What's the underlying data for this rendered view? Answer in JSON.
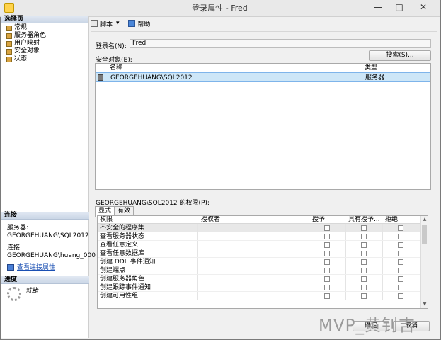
{
  "window": {
    "title": "登录属性 - Fred",
    "controls": {
      "minimize": "—",
      "maximize": "□",
      "close": "✕"
    }
  },
  "left": {
    "select_page_header": "选择页",
    "pages": [
      {
        "label": "常规",
        "icon": "wrench-icon"
      },
      {
        "label": "服务器角色",
        "icon": "wrench-icon"
      },
      {
        "label": "用户映射",
        "icon": "wrench-icon"
      },
      {
        "label": "安全对象",
        "icon": "wrench-icon"
      },
      {
        "label": "状态",
        "icon": "wrench-icon"
      }
    ],
    "connection_header": "连接",
    "server_label": "服务器:",
    "server_value": "GEORGEHUANG\\SQL2012",
    "connection_label": "连接:",
    "connection_value": "GEORGEHUANG\\huang_000",
    "view_connection_link": "查看连接属性",
    "progress_header": "进度",
    "progress_status": "就绪"
  },
  "toolbar": {
    "script_label": "脚本",
    "script_dropdown": "▾",
    "help_label": "帮助"
  },
  "form": {
    "login_name_label": "登录名(N):",
    "login_name_value": "Fred",
    "securables_label": "安全对象(E):",
    "search_button": "搜索(S)..."
  },
  "securables_list": {
    "columns": [
      "名称",
      "类型"
    ],
    "rows": [
      {
        "name": "GEORGEHUANG\\SQL2012",
        "type": "服务器"
      }
    ]
  },
  "permissions": {
    "label": "GEORGEHUANG\\SQL2012 的权限(P):",
    "tabs": [
      "显式",
      "有效"
    ],
    "columns": [
      "权限",
      "授权者",
      "授予",
      "具有授予...",
      "拒绝"
    ],
    "rows": [
      "不安全的程序集",
      "查看服务器状态",
      "查看任意定义",
      "查看任意数据库",
      "创建 DDL 事件通知",
      "创建端点",
      "创建服务器角色",
      "创建跟踪事件通知",
      "创建可用性组"
    ]
  },
  "buttons": {
    "ok": "确定",
    "cancel": "取消"
  },
  "watermark": "MVP_黄钊吉"
}
